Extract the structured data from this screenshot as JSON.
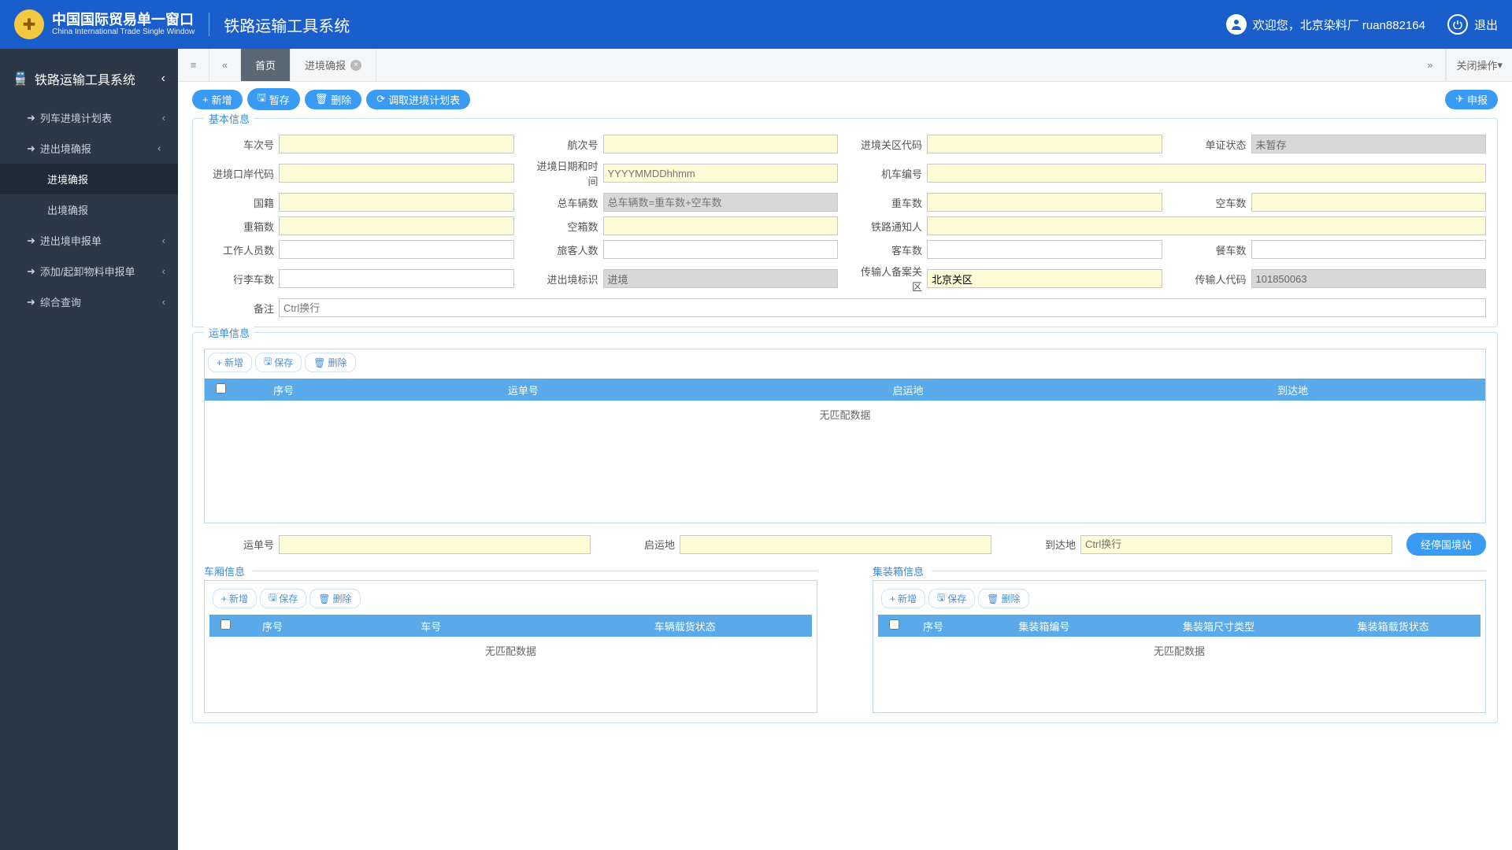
{
  "header": {
    "brand_cn": "中国国际贸易单一窗口",
    "brand_en": "China International Trade Single Window",
    "system_title": "铁路运输工具系统",
    "welcome": "欢迎您，北京染料厂 ruan882164",
    "logout": "退出"
  },
  "sidebar": {
    "title": "铁路运输工具系统",
    "items": [
      {
        "label": "列车进境计划表",
        "icon": "arrow-right-icon"
      },
      {
        "label": "进出境确报",
        "icon": "arrow-right-icon",
        "expanded": true,
        "children": [
          {
            "label": "进境确报",
            "active": true
          },
          {
            "label": "出境确报"
          }
        ]
      },
      {
        "label": "进出境申报单",
        "icon": "arrow-right-icon"
      },
      {
        "label": "添加/起卸物料申报单",
        "icon": "arrow-right-icon"
      },
      {
        "label": "综合查询",
        "icon": "arrow-right-icon"
      }
    ]
  },
  "tabs": {
    "home": "首页",
    "current": "进境确报",
    "close_ops": "关闭操作"
  },
  "toolbar": {
    "add": "新增",
    "save_temp": "暂存",
    "delete": "删除",
    "fetch_plan": "调取进境计划表",
    "submit": "申报"
  },
  "basic": {
    "title": "基本信息",
    "labels": {
      "train_no": "车次号",
      "voyage_no": "航次号",
      "customs_area": "进境关区代码",
      "doc_status": "单证状态",
      "port_code": "进境口岸代码",
      "entry_dt": "进境日期和时间",
      "loco_no": "机车编号",
      "nationality": "国籍",
      "total_cars": "总车辆数",
      "loaded_cars": "重车数",
      "empty_cars": "空车数",
      "loaded_boxes": "重箱数",
      "empty_boxes": "空箱数",
      "rail_notifier": "铁路通知人",
      "staff_cnt": "工作人员数",
      "passenger_cnt": "旅客人数",
      "passenger_cars": "客车数",
      "dining_cars": "餐车数",
      "luggage_cars": "行李车数",
      "io_flag": "进出境标识",
      "filer_area": "传输人备案关区",
      "filer_code": "传输人代码",
      "remark": "备注"
    },
    "placeholders": {
      "entry_dt": "YYYYMMDDhhmm",
      "total_cars": "总车辆数=重车数+空车数",
      "remark": "Ctrl换行",
      "to_place": "Ctrl换行"
    },
    "values": {
      "doc_status": "未暂存",
      "io_flag": "进境",
      "filer_area": "北京关区",
      "filer_code": "101850063"
    }
  },
  "waybill": {
    "title": "运单信息",
    "btns": {
      "add": "新增",
      "save": "保存",
      "delete": "删除"
    },
    "cols": [
      "序号",
      "运单号",
      "启运地",
      "到达地"
    ],
    "empty_text": "无匹配数据",
    "fields": {
      "waybill_no": "运单号",
      "from": "启运地",
      "to": "到达地"
    },
    "route_btn": "经停国境站"
  },
  "car_info": {
    "title": "车厢信息",
    "btns": {
      "add": "新增",
      "save": "保存",
      "delete": "删除"
    },
    "cols": [
      "序号",
      "车号",
      "车辆载货状态"
    ],
    "empty_text": "无匹配数据"
  },
  "container_info": {
    "title": "集装箱信息",
    "btns": {
      "add": "新增",
      "save": "保存",
      "delete": "删除"
    },
    "cols": [
      "序号",
      "集装箱编号",
      "集装箱尺寸类型",
      "集装箱载货状态"
    ],
    "empty_text": "无匹配数据"
  }
}
